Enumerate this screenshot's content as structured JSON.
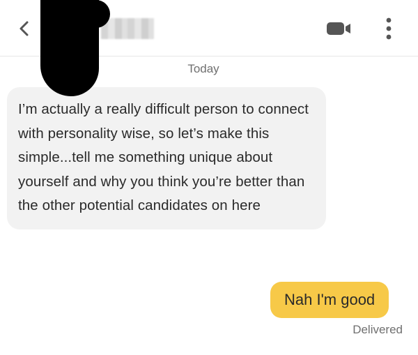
{
  "header": {
    "back_icon": "chevron-left-icon",
    "video_icon": "video-camera-icon",
    "more_icon": "more-vertical-icon"
  },
  "conversation": {
    "date_separator": "Today",
    "messages": [
      {
        "direction": "incoming",
        "text": "I’m actually a really difficult person to connect with personality wise, so let’s make this simple...tell me something unique about yourself and why you think you’re better than the other potential candidates on here"
      },
      {
        "direction": "outgoing",
        "text": "Nah I'm good",
        "status": "Delivered"
      }
    ]
  },
  "colors": {
    "outgoing_bubble": "#f7c948",
    "incoming_bubble": "#f2f2f2",
    "icon_gray": "#555555"
  }
}
